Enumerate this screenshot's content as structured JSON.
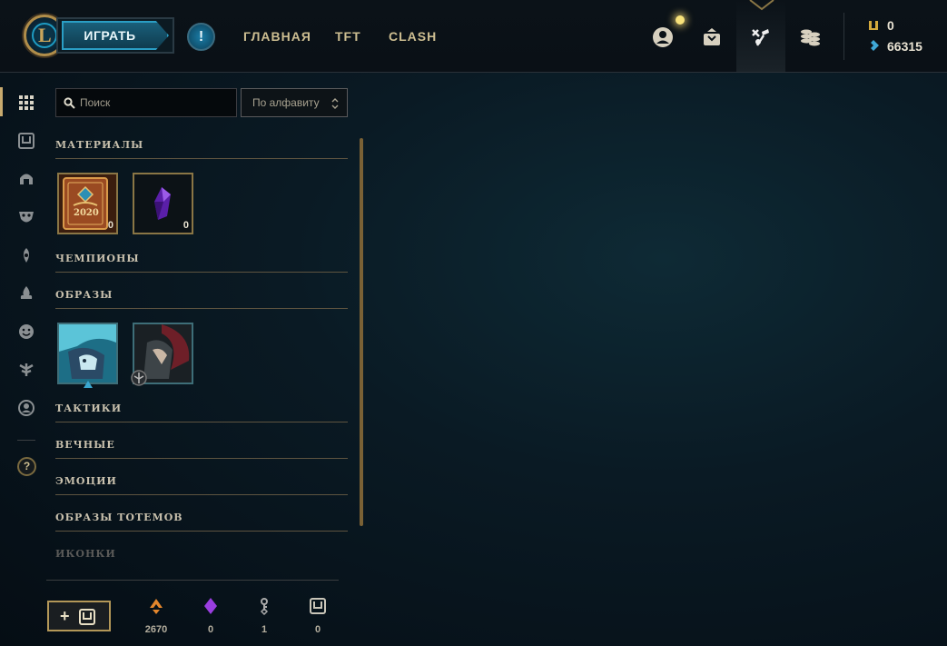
{
  "header": {
    "play_label": "ИГРАТЬ",
    "alert_symbol": "!",
    "nav": [
      "ГЛАВНАЯ",
      "TFT",
      "CLASH"
    ],
    "icons": [
      "profile-icon",
      "collection-icon",
      "crafting-icon",
      "store-icon"
    ],
    "currency": {
      "blue_essence_label": "0",
      "rp_label": "66315"
    },
    "logo_letter": "L"
  },
  "rail": {
    "items": [
      "grid-icon",
      "chest-icon",
      "helmet-icon",
      "mask-icon",
      "ward-icon",
      "flame-icon",
      "emote-icon",
      "tree-icon",
      "profile-circle-icon"
    ],
    "help_symbol": "?"
  },
  "search": {
    "placeholder": "Поиск"
  },
  "sort": {
    "label": "По алфавиту"
  },
  "sections": {
    "materials": "МАТЕРИАЛЫ",
    "champions": "ЧЕМПИОНЫ",
    "skins": "ОБРАЗЫ",
    "tactics": "ТАКТИКИ",
    "eternals": "ВЕЧНЫЕ",
    "emotes": "ЭМОЦИИ",
    "totem_skins": "ОБРАЗЫ ТОТЕМОВ",
    "icons": "ИКОНКИ"
  },
  "materials": [
    {
      "name": "event-pass-2020-icon",
      "year_label": "2020",
      "count": "0"
    },
    {
      "name": "mythic-essence-icon",
      "count": "0"
    }
  ],
  "bottom": {
    "add_label": "+",
    "stats": [
      {
        "icon": "orange-essence-icon",
        "value": "2670"
      },
      {
        "icon": "mythic-essence-icon",
        "value": "0"
      },
      {
        "icon": "key-fragment-icon",
        "value": "1"
      },
      {
        "icon": "chest-icon",
        "value": "0"
      }
    ]
  },
  "colors": {
    "gold": "#c8aa6e",
    "accent_blue": "#1e9bc2"
  }
}
